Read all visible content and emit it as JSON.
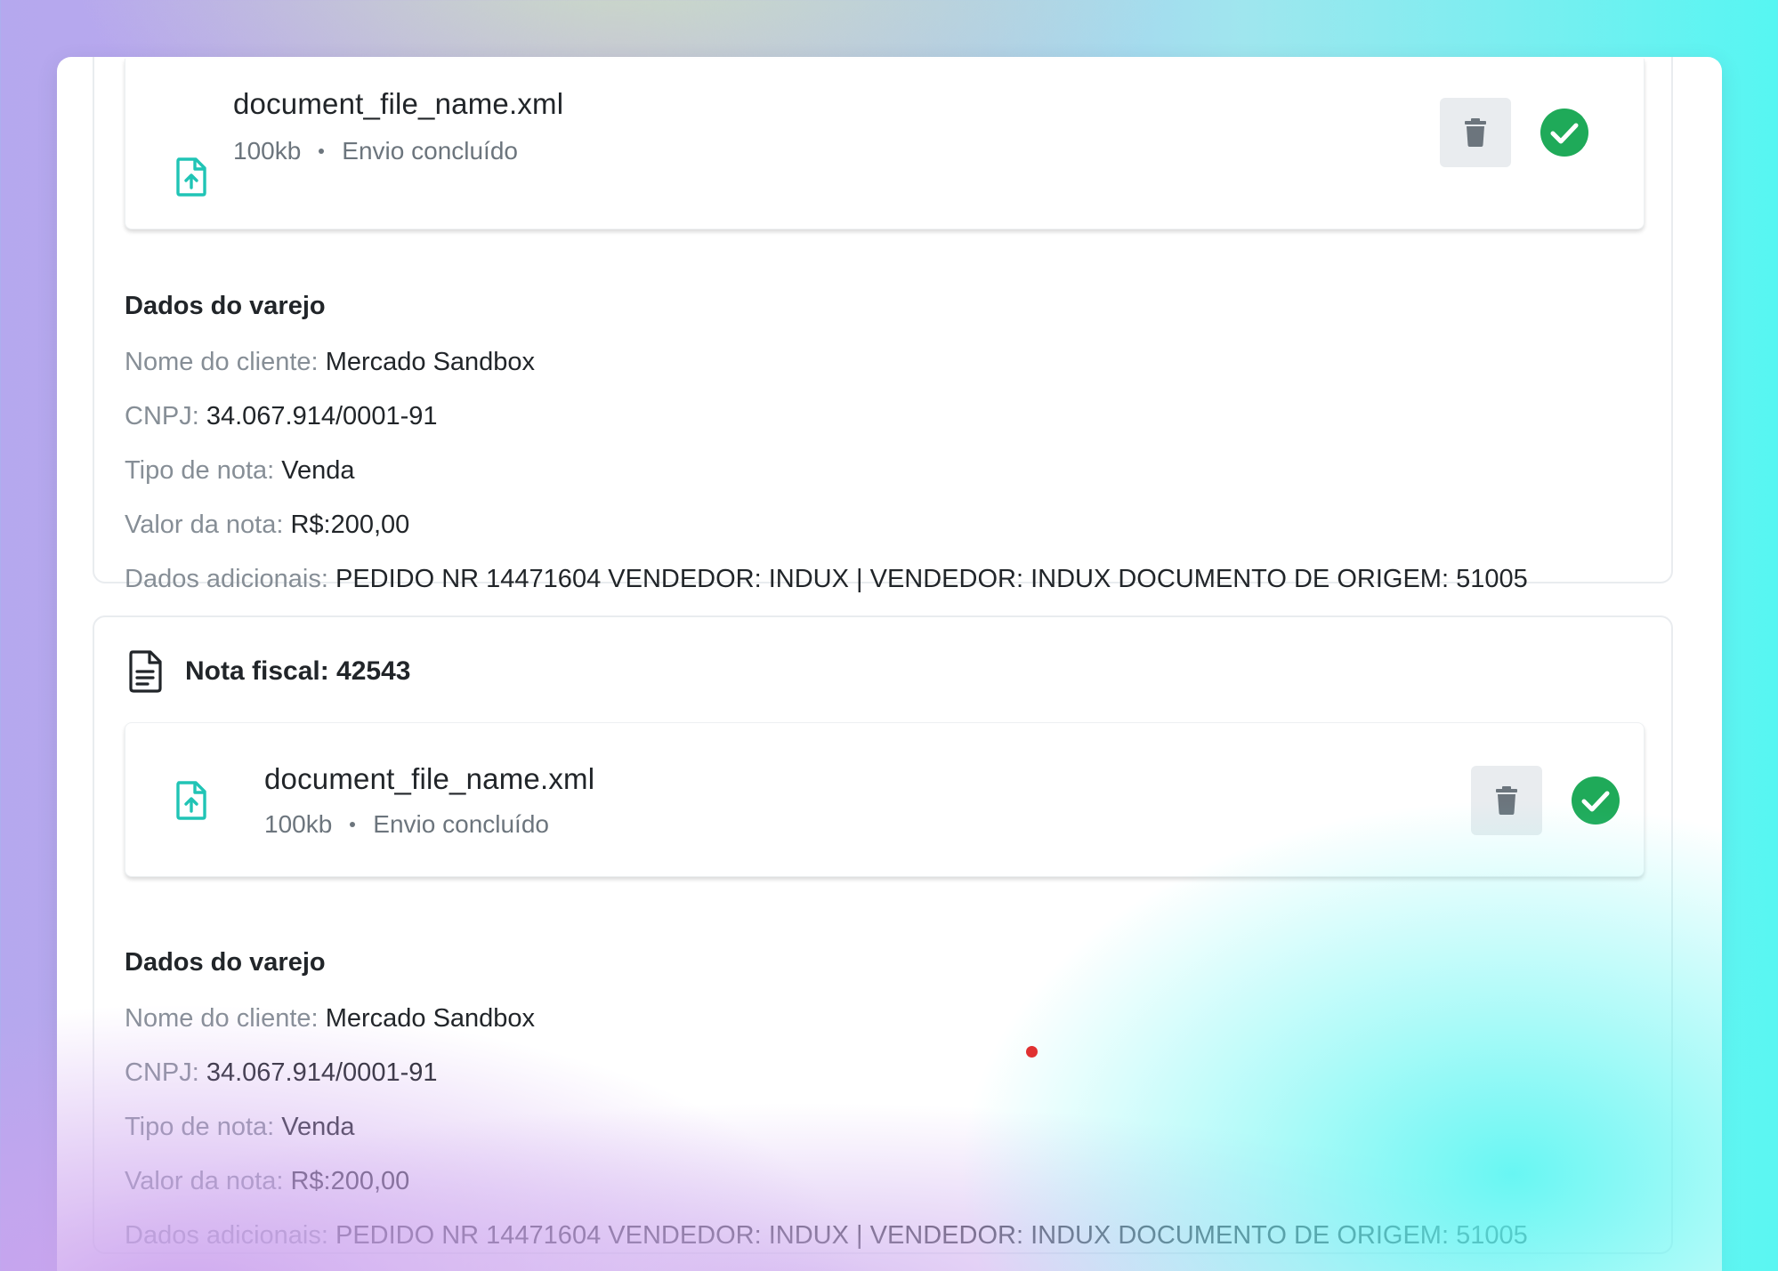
{
  "colors": {
    "accent_teal": "#20c4b5",
    "success_green": "#1faa59",
    "text_primary": "#212529",
    "text_secondary": "#868e96"
  },
  "invoices": [
    {
      "file": {
        "icon": "file-upload-icon",
        "name": "document_file_name.xml",
        "size": "100kb",
        "status": "Envio concluído",
        "delete_icon": "trash-icon",
        "status_icon": "check-circle-icon"
      },
      "retail": {
        "title": "Dados do varejo",
        "client_label": "Nome do cliente:",
        "client_value": "Mercado Sandbox",
        "cnpj_label": "CNPJ:",
        "cnpj_value": "34.067.914/0001-91",
        "type_label": "Tipo de nota:",
        "type_value": "Venda",
        "amount_label": "Valor da nota:",
        "amount_value": "R$:200,00",
        "extra_label": "Dados adicionais:",
        "extra_value": "PEDIDO NR 14471604 VENDEDOR: INDUX | VENDEDOR: INDUX DOCUMENTO DE ORIGEM: 51005"
      }
    },
    {
      "header": {
        "icon": "document-icon",
        "title": "Nota fiscal: 42543"
      },
      "file": {
        "icon": "file-upload-icon",
        "name": "document_file_name.xml",
        "size": "100kb",
        "status": "Envio concluído",
        "delete_icon": "trash-icon",
        "status_icon": "check-circle-icon"
      },
      "retail": {
        "title": "Dados do varejo",
        "client_label": "Nome do cliente:",
        "client_value": "Mercado Sandbox",
        "cnpj_label": "CNPJ:",
        "cnpj_value": "34.067.914/0001-91",
        "type_label": "Tipo de nota:",
        "type_value": "Venda",
        "amount_label": "Valor da nota:",
        "amount_value": "R$:200,00",
        "extra_label": "Dados adicionais:",
        "extra_value": "PEDIDO NR 14471604 VENDEDOR: INDUX | VENDEDOR: INDUX DOCUMENTO DE ORIGEM: 51005"
      }
    }
  ]
}
